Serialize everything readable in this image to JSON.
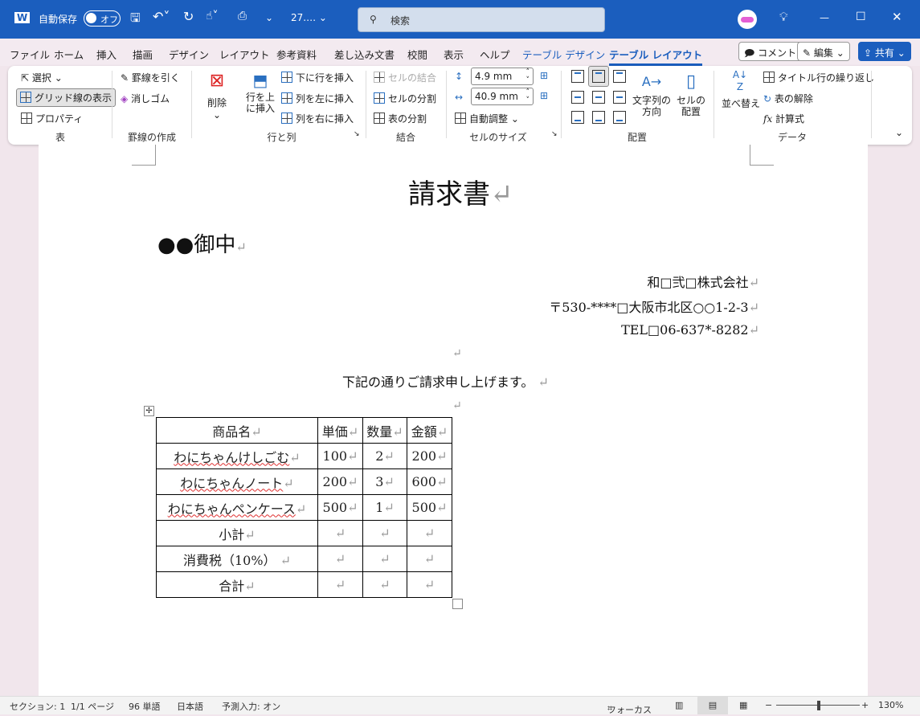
{
  "titlebar": {
    "autosave_label": "自動保存",
    "autosave_state": "オフ",
    "filename": "27.…",
    "search_placeholder": "検索",
    "window_controls": [
      "minimize",
      "maximize",
      "close"
    ]
  },
  "tabs": [
    "ファイル",
    "ホーム",
    "挿入",
    "描画",
    "デザイン",
    "レイアウト",
    "参考資料",
    "差し込み文書",
    "校閲",
    "表示",
    "ヘルプ",
    "テーブル デザイン",
    "テーブル レイアウト"
  ],
  "active_tab": "テーブル レイアウト",
  "tab_buttons": {
    "comment": "コメント",
    "edit": "編集",
    "share": "共有"
  },
  "ribbon": {
    "table": {
      "label": "表",
      "select": "選択",
      "gridlines": "グリッド線の表示",
      "properties": "プロパティ"
    },
    "draw": {
      "label": "罫線の作成",
      "draw_table": "罫線を引く",
      "eraser": "消しゴム"
    },
    "rows_cols": {
      "label": "行と列",
      "delete": "削除",
      "insert_above_1": "行を上",
      "insert_above_2": "に挿入",
      "insert_below": "下に行を挿入",
      "insert_left": "列を左に挿入",
      "insert_right": "列を右に挿入"
    },
    "merge": {
      "label": "結合",
      "merge_cells": "セルの結合",
      "split_cells": "セルの分割",
      "split_table": "表の分割"
    },
    "cell_size": {
      "label": "セルのサイズ",
      "height": "4.9 mm",
      "width": "40.9 mm",
      "autofit": "自動調整"
    },
    "alignment": {
      "label": "配置",
      "text_direction_1": "文字列の",
      "text_direction_2": "方向",
      "cell_margins_1": "セルの",
      "cell_margins_2": "配置"
    },
    "data": {
      "label": "データ",
      "sort": "並べ替え",
      "repeat_header": "タイトル行の繰り返し",
      "convert": "表の解除",
      "formula": "計算式"
    }
  },
  "document": {
    "title": "請求書",
    "recipient": "●●御中",
    "company": "和□弐□株式会社",
    "address": "〒530-****□大阪市北区○○1-2-3",
    "tel": "TEL□06-637*-8282",
    "intro": "下記の通りご請求申し上げます。",
    "table": {
      "headers": [
        "商品名",
        "単価",
        "数量",
        "金額"
      ],
      "rows": [
        [
          "わにちゃんけしごむ",
          "100",
          "2",
          "200"
        ],
        [
          "わにちゃんノート",
          "200",
          "3",
          "600"
        ],
        [
          "わにちゃんペンケース",
          "500",
          "1",
          "500"
        ],
        [
          "小計",
          "",
          "",
          ""
        ],
        [
          "消費税（10%）",
          "",
          "",
          ""
        ],
        [
          "合計",
          "",
          "",
          ""
        ]
      ]
    }
  },
  "status": {
    "section": "セクション: 1",
    "page": "1/1 ページ",
    "words": "96 単語",
    "language": "日本語",
    "predictive": "予測入力: オン",
    "focus": "フォーカス",
    "zoom": "130%",
    "zoom_level_percent": 130
  },
  "colors": {
    "brand": "#1b5ebe",
    "spell_error": "#e03030"
  }
}
